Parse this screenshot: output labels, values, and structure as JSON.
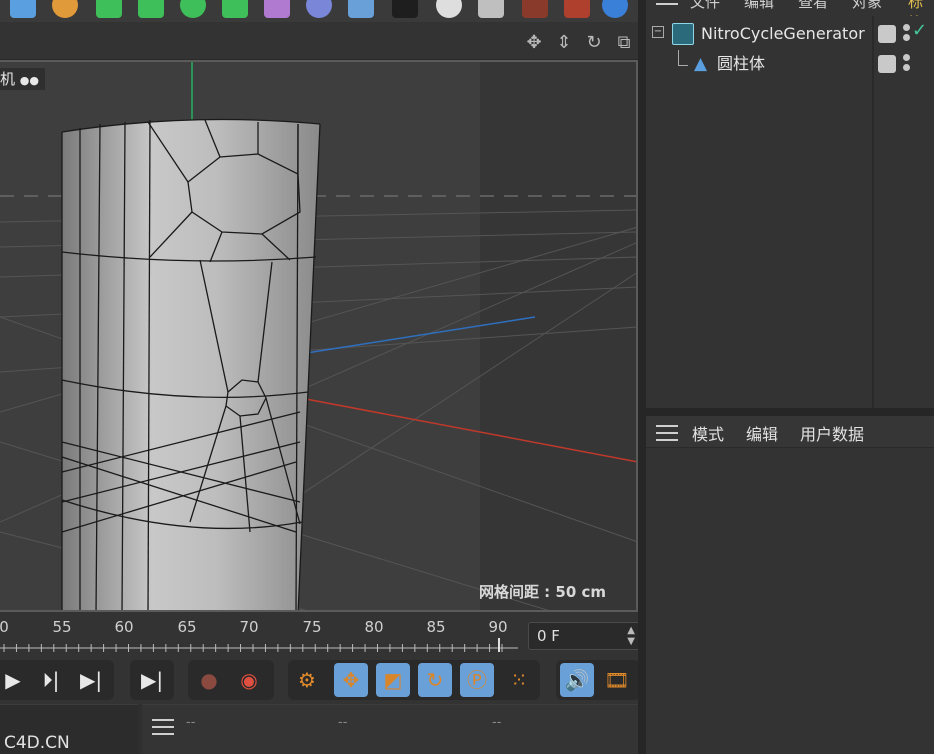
{
  "viewport": {
    "camera_label": "机",
    "grid_spacing": "网格间距 : 50 cm"
  },
  "timeline": {
    "ticks": [
      "0",
      "55",
      "60",
      "65",
      "70",
      "75",
      "80",
      "85",
      "90"
    ],
    "current_frame": "0 F"
  },
  "object_manager": {
    "menu": [
      "文件",
      "编辑",
      "查看",
      "对象",
      "标签"
    ],
    "objects": [
      {
        "name": "NitroCycleGenerator"
      },
      {
        "name": "圆柱体"
      }
    ]
  },
  "attribute_manager": {
    "tabs": [
      "模式",
      "编辑",
      "用户数据"
    ]
  },
  "bottom": {
    "watermark": "C4D.CN",
    "placeholders": [
      "--",
      "--",
      "--"
    ]
  },
  "colors": {
    "accent_orange": "#e08a2a",
    "tool_blue": "#6aa0d8",
    "axis_x": "#c0392b",
    "axis_y": "#27ae60",
    "axis_z": "#2f6fc0",
    "check_green": "#47c7a0"
  }
}
